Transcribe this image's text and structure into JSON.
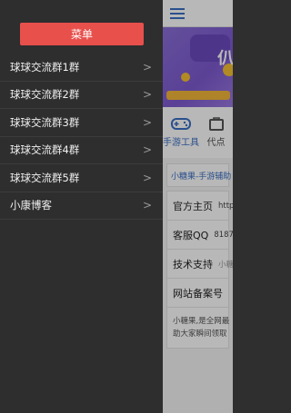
{
  "drawer": {
    "menu_button": "菜单",
    "items": [
      {
        "label": "球球交流群1群",
        "chevron": ">"
      },
      {
        "label": "球球交流群2群",
        "chevron": ">"
      },
      {
        "label": "球球交流群3群",
        "chevron": ">"
      },
      {
        "label": "球球交流群4群",
        "chevron": ">"
      },
      {
        "label": "球球交流群5群",
        "chevron": ">"
      },
      {
        "label": "小康博客",
        "chevron": ">"
      }
    ]
  },
  "main": {
    "banner_text": "仈",
    "tools": [
      {
        "label": "手游工具",
        "icon": "gamepad-icon"
      },
      {
        "label": "代点",
        "icon": "bag-icon"
      }
    ],
    "notice": "小糖果-手游辅助",
    "info": [
      {
        "key": "官方主页",
        "value": "http"
      },
      {
        "key": "客服QQ",
        "value": "8187"
      },
      {
        "key": "技术支持",
        "value": "小糖"
      },
      {
        "key": "网站备案号",
        "value": ""
      }
    ],
    "desc_line1": "小糖果,是全网最",
    "desc_line2": "助大家瞬间领取"
  },
  "colors": {
    "drawer_bg": "#2e2e2e",
    "menu_button": "#e8504c",
    "accent": "#3b6fc4",
    "banner": "#8a6fd8"
  }
}
